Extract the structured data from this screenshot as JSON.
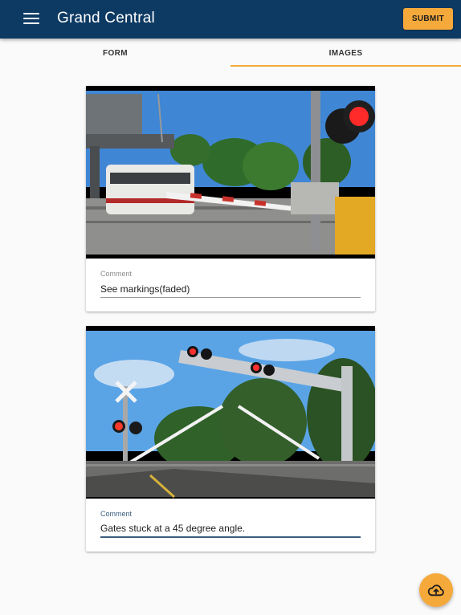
{
  "app": {
    "title": "Grand Central"
  },
  "toolbar": {
    "submit_label": "SUBMIT",
    "menu_icon": "menu-icon"
  },
  "tabs": [
    {
      "label": "FORM",
      "active": false
    },
    {
      "label": "IMAGES",
      "active": true
    }
  ],
  "images": [
    {
      "comment_label": "Comment",
      "comment_value": "See markings(faded)"
    },
    {
      "comment_label": "Comment",
      "comment_value": "Gates stuck at a 45 degree angle."
    }
  ],
  "fab": {
    "icon": "cloud-upload-icon"
  },
  "colors": {
    "appbar": "#0d3a63",
    "accent": "#f5a93a",
    "focus": "#3a5e7f"
  }
}
